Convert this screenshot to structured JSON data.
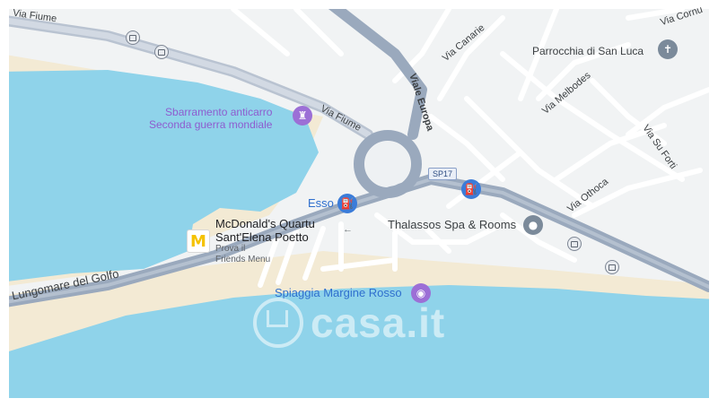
{
  "map": {
    "colors": {
      "water": "#8fd3ea",
      "sand": "#f3ead4",
      "land": "#f1f3f4",
      "major_road": "#9aa9bd",
      "minor_road": "#ffffff",
      "poi_purple": "#9c6fd6",
      "poi_blue": "#3b7cd9",
      "poi_gray": "#7b8a9a",
      "mcdonalds_yellow": "#f5c200"
    },
    "roads": {
      "via_fiume_nw": "Via Fiume",
      "via_fiume": "Via Fiume",
      "viale_europa": "Viale Europa",
      "via_canarie": "Via Canarie",
      "via_cornus": "Via Cornu",
      "via_melbodes": "Via Melbodes",
      "via_su_forti": "Via Su Forti",
      "via_othoca": "Via Othoca",
      "lungomare": "Lungomare del Golfo",
      "sp17": "SP17"
    },
    "pois": {
      "sbarramento": {
        "line1": "Sbarramento anticarro",
        "line2": "Seconda guerra mondiale",
        "icon": "landmark-icon"
      },
      "parrocchia": {
        "label": "Parrocchia di San Luca",
        "icon": "church-icon"
      },
      "esso": {
        "label": "Esso",
        "icon": "gas-station-icon"
      },
      "mcdonalds": {
        "line1": "McDonald's Quartu",
        "line2": "Sant'Elena Poetto",
        "sub1": "Prova il",
        "sub2": "Friends Menu",
        "icon": "mcdonalds-logo-icon"
      },
      "thalassos": {
        "label": "Thalassos Spa & Rooms",
        "icon": "place-pin-icon"
      },
      "spiaggia": {
        "label": "Spiaggia Margine Rosso",
        "icon": "camera-icon"
      }
    },
    "watermark": "casa.it"
  }
}
